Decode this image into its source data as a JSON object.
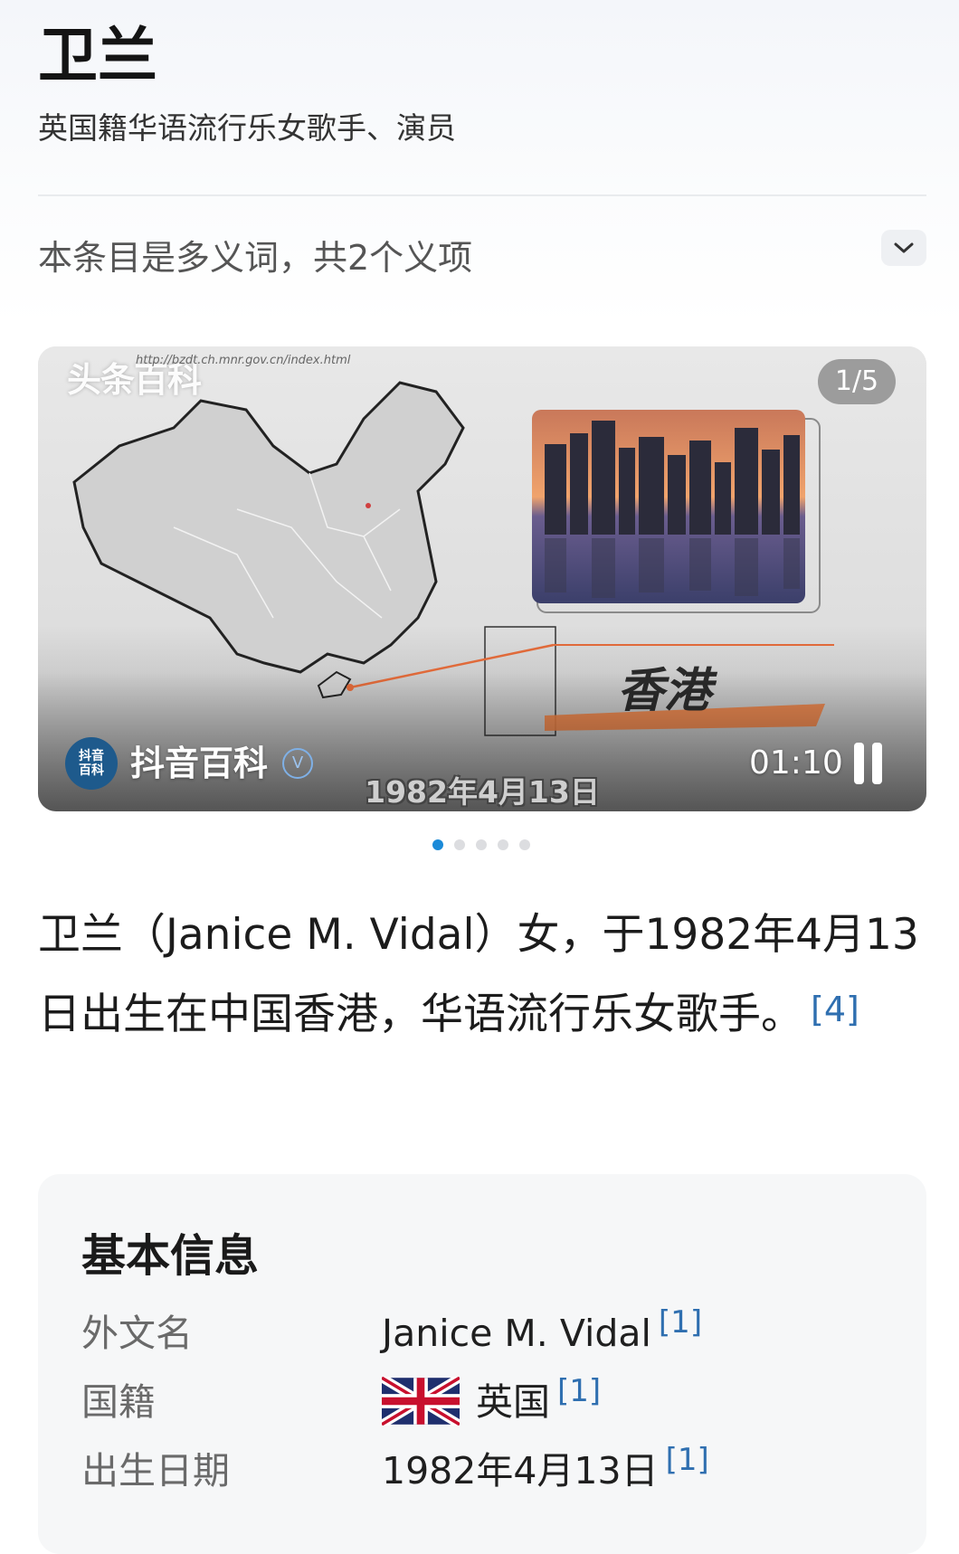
{
  "header": {
    "title": "卫兰",
    "subtitle": "英国籍华语流行乐女歌手、演员"
  },
  "disambiguation": {
    "text": "本条目是多义词，共2个义项",
    "toggle_icon": "chevron-down-icon"
  },
  "media": {
    "counter": "1/5",
    "watermark": "头条百科",
    "watermark_url": "http://bzdt.ch.mnr.gov.cn/index.html",
    "map_label_city": "香港",
    "channel": {
      "logo_text": "抖音百科",
      "name": "抖音百科",
      "verified_icon": "verified-badge-icon"
    },
    "caption": "1982年4月13日",
    "time": "01:10",
    "control_icon": "pause-icon",
    "dots_total": 5,
    "dots_active": 1
  },
  "intro": {
    "text": "卫兰（Janice M. Vidal）女，于1982年4月13日出生在中国香港，华语流行乐女歌手。",
    "citation": "[4]"
  },
  "info": {
    "heading": "基本信息",
    "rows": [
      {
        "label": "外文名",
        "value": "Janice M. Vidal",
        "citation": "[1]"
      },
      {
        "label": "国籍",
        "value": "英国",
        "citation": "[1]",
        "icon": "uk-flag-icon"
      },
      {
        "label": "出生日期",
        "value": "1982年4月13日",
        "citation": "[1]"
      }
    ]
  },
  "colors": {
    "accent": "#2f6fb0",
    "active_dot": "#1b8ad8",
    "map_highlight": "#e06a3a"
  }
}
